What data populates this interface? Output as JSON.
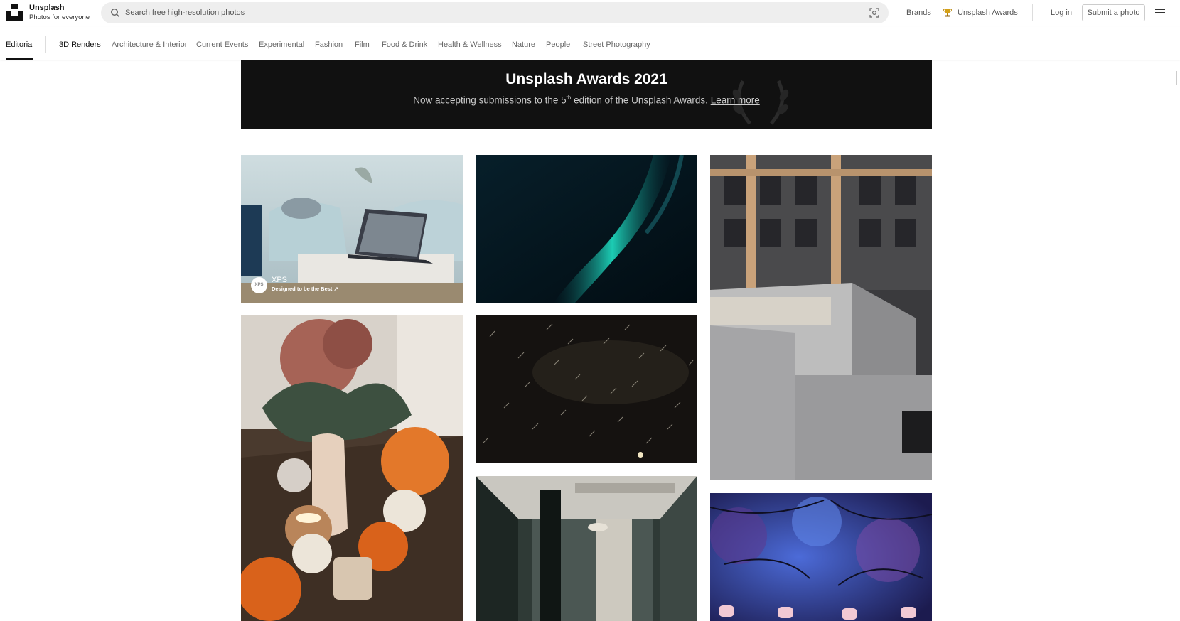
{
  "brand": {
    "name": "Unsplash",
    "tagline": "Photos for everyone"
  },
  "search": {
    "placeholder": "Search free high-resolution photos"
  },
  "header": {
    "brands": "Brands",
    "awards": "Unsplash Awards",
    "login": "Log in",
    "submit": "Submit a photo"
  },
  "topics": [
    "Editorial",
    "3D Renders",
    "Architecture & Interior",
    "Current Events",
    "Experimental",
    "Fashion",
    "Film",
    "Food & Drink",
    "Health & Wellness",
    "Nature",
    "People",
    "Street Photography"
  ],
  "active_topic": "Editorial",
  "banner": {
    "title": "Unsplash Awards 2021",
    "text_before": "Now accepting submissions to the 5",
    "text_sup": "th",
    "text_after": " edition of the Unsplash Awards. ",
    "link": "Learn more"
  },
  "sponsored": {
    "logo_text": "XPS",
    "name": "XPS",
    "tagline": "Designed to be the Best ↗"
  },
  "photos": [
    {
      "subject": "laptop on coffee table in living room"
    },
    {
      "subject": "pumpkins and flower vase on wooden table"
    },
    {
      "subject": "green aurora streak in dark sky"
    },
    {
      "subject": "star trails at night"
    },
    {
      "subject": "industrial interior with pipes and pillar"
    },
    {
      "subject": "modern building facade at sunset"
    },
    {
      "subject": "blue cherry blossoms with lanterns"
    }
  ],
  "colors": {
    "accent": "#111111",
    "banner_bg": "#111111",
    "search_bg": "#eeeeee"
  }
}
